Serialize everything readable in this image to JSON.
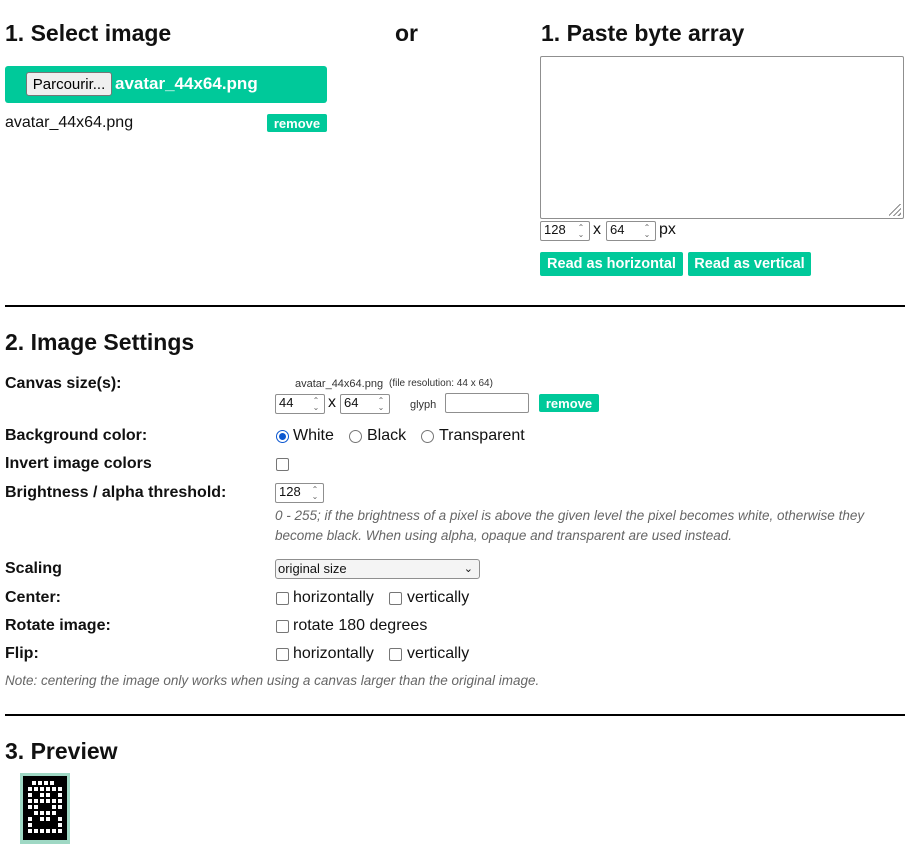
{
  "section1": {
    "select_title": "1. Select image",
    "or_label": "or",
    "paste_title": "1. Paste byte array",
    "browse_label": "Parcourir...",
    "selected_file": "avatar_44x64.png",
    "file_list_name": "avatar_44x64.png",
    "remove_label": "remove",
    "byte_array_value": "",
    "width_value": "128",
    "x_label": "x",
    "height_value": "64",
    "px_label": "px",
    "read_horizontal_label": "Read as horizontal",
    "read_vertical_label": "Read as vertical"
  },
  "section2": {
    "title": "2. Image Settings",
    "canvas_label": "Canvas size(s):",
    "canvas_file": "avatar_44x64.png",
    "canvas_resolution": "(file resolution: 44 x 64)",
    "canvas_width": "44",
    "canvas_x": "x",
    "canvas_height": "64",
    "glyph_label": "glyph",
    "glyph_value": "",
    "canvas_remove_label": "remove",
    "background_label": "Background color:",
    "bg_options": [
      "White",
      "Black",
      "Transparent"
    ],
    "bg_selected": "White",
    "invert_label": "Invert image colors",
    "invert_checked": false,
    "threshold_label": "Brightness / alpha threshold:",
    "threshold_value": "128",
    "threshold_hint": "0 - 255; if the brightness of a pixel is above the given level the pixel becomes white, otherwise they become black. When using alpha, opaque and transparent are used instead.",
    "scaling_label": "Scaling",
    "scaling_selected": "original size",
    "center_label": "Center:",
    "center_h_label": "horizontally",
    "center_v_label": "vertically",
    "rotate_label": "Rotate image:",
    "rotate_option_label": "rotate 180 degrees",
    "flip_label": "Flip:",
    "flip_h_label": "horizontally",
    "flip_v_label": "vertically",
    "note": "Note: centering the image only works when using a canvas larger than the original image."
  },
  "section3": {
    "title": "3. Preview"
  },
  "colors": {
    "accent": "#00c99a",
    "radio_selected": "#0b57d0"
  }
}
